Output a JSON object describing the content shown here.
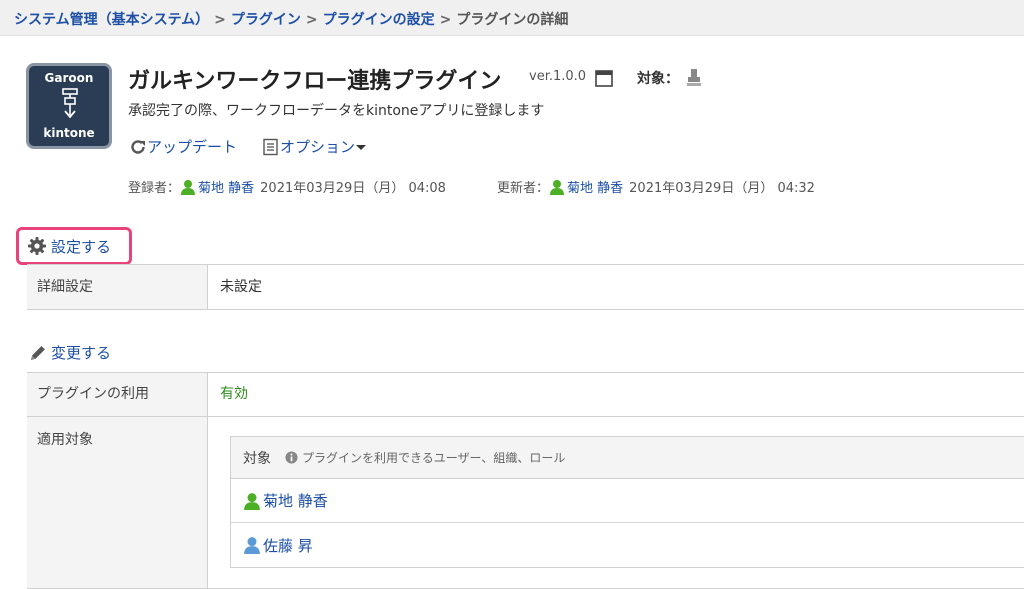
{
  "breadcrumb": {
    "items": [
      "システム管理（基本システム）",
      "プラグイン",
      "プラグインの設定"
    ],
    "separator": ">",
    "current": "プラグインの詳細"
  },
  "plugin": {
    "icon_top": "Garoon",
    "icon_bottom": "kintone",
    "title": "ガルキンワークフロー連携プラグイン",
    "version": "ver.1.0.0",
    "target_label": "対象：",
    "description": "承認完了の際、ワークフローデータをkintoneアプリに登録します"
  },
  "actions": {
    "update": "アップデート",
    "option": "オプション"
  },
  "meta": {
    "registered_label": "登録者：",
    "registered_user": "菊地 静香",
    "registered_date": "2021年03月29日（月） 04:08",
    "updated_label": "更新者：",
    "updated_user": "菊地 静香",
    "updated_date": "2021年03月29日（月） 04:32"
  },
  "settings": {
    "link": "設定する",
    "detail_label": "詳細設定",
    "detail_value": "未設定"
  },
  "usage": {
    "change_link": "変更する",
    "usage_label": "プラグインの利用",
    "usage_value": "有効",
    "scope_label": "適用対象",
    "table_header": "対象",
    "table_hint": "プラグインを利用できるユーザー、組織、ロール",
    "users": [
      "菊地 静香",
      "佐藤 昇"
    ]
  },
  "colors": {
    "link": "#1c4fa5",
    "enabled": "#2e8b1e",
    "highlight": "#e8437a",
    "user_green": "#4caf25",
    "user_blue": "#5b9ad6"
  }
}
